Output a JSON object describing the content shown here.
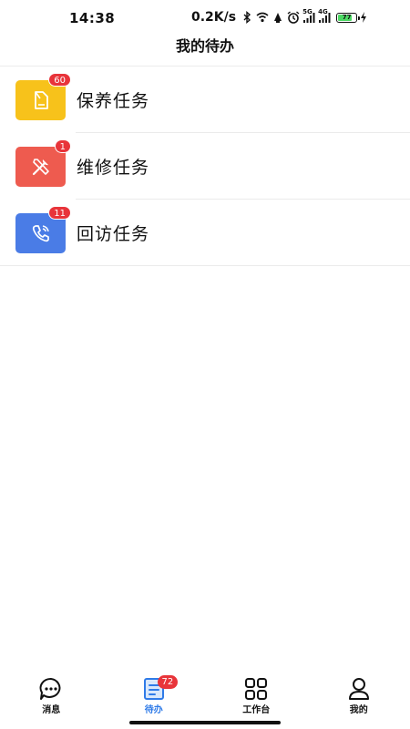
{
  "status_bar": {
    "time": "14:38",
    "net_speed": "0.2K/s",
    "signal_5g": "5G",
    "signal_4g": "4G",
    "battery_level": "77",
    "icons": [
      "bluetooth-icon",
      "wifi-icon",
      "vibrate-icon",
      "alarm-icon",
      "signal-5g-icon",
      "signal-4g-icon",
      "battery-icon",
      "charging-icon"
    ]
  },
  "header": {
    "title": "我的待办"
  },
  "tasks": [
    {
      "label": "保养任务",
      "badge": "60",
      "icon": "document-icon",
      "color": "#f7c21b"
    },
    {
      "label": "维修任务",
      "badge": "1",
      "icon": "tools-icon",
      "color": "#ee5b4f"
    },
    {
      "label": "回访任务",
      "badge": "11",
      "icon": "phone-icon",
      "color": "#4a7ce6"
    }
  ],
  "bottom_nav": [
    {
      "label": "消息",
      "icon": "chat-icon",
      "active": false
    },
    {
      "label": "待办",
      "icon": "todo-list-icon",
      "active": true,
      "badge": "72"
    },
    {
      "label": "工作台",
      "icon": "grid-icon",
      "active": false
    },
    {
      "label": "我的",
      "icon": "user-icon",
      "active": false
    }
  ],
  "colors": {
    "accent": "#2f7be8",
    "badge": "#e8343a"
  }
}
